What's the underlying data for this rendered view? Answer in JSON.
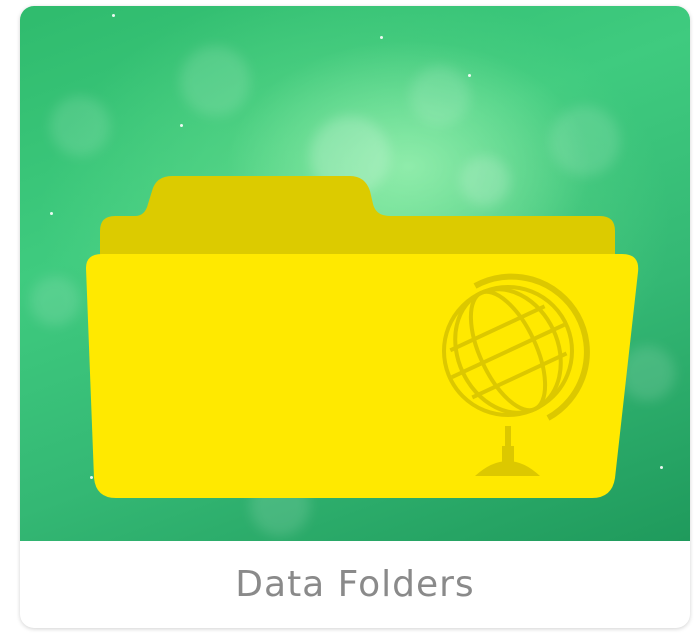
{
  "tile": {
    "label": "Data Folders",
    "icon": "folder-globe-icon"
  },
  "colors": {
    "background_green": "#3fcb7f",
    "folder_back": "#dccb00",
    "folder_front": "#ffe900",
    "globe_line": "#dcc800",
    "label_text": "#8a8a8a"
  }
}
